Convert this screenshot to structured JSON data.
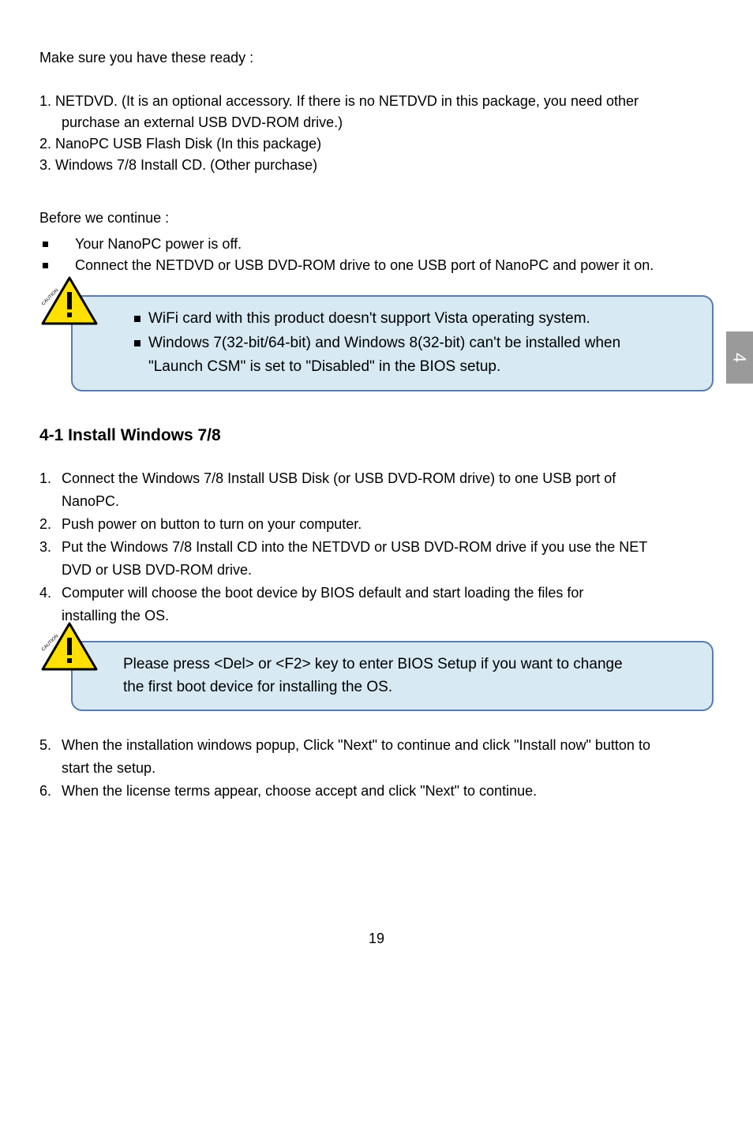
{
  "intro": "Make sure you have these ready :",
  "prereq": {
    "item1a": "1. NETDVD. (It is an optional accessory. If there is no NETDVD in this package, you need other",
    "item1b": "purchase an external USB DVD-ROM drive.)",
    "item2": "2. NanoPC USB Flash Disk (In this package)",
    "item3": "3. Windows 7/8 Install CD. (Other purchase)"
  },
  "before_heading": "Before we continue :",
  "before": {
    "b1": "Your NanoPC power is off.",
    "b2": "Connect the NETDVD or USB DVD-ROM drive to one USB port of NanoPC and power it on."
  },
  "caution_label": "CAUTION",
  "caution1": {
    "l1": "WiFi card with this product doesn't support Vista operating system.",
    "l2": "Windows 7(32-bit/64-bit) and Windows 8(32-bit) can't be installed when",
    "l3": "\"Launch CSM\" is set to \"Disabled\" in the BIOS setup."
  },
  "section_title": "4-1 Install Windows 7/8",
  "steps": {
    "s1a": "Connect the Windows 7/8 Install USB Disk (or USB DVD-ROM drive) to one USB port of",
    "s1b": "NanoPC.",
    "s2": "Push power on button to turn on your computer.",
    "s3a": "Put the Windows 7/8 Install CD into the NETDVD or USB DVD-ROM drive if you use the NET",
    "s3b": "DVD or USB DVD-ROM drive.",
    "s4a": "Computer will choose the boot device by BIOS default and start loading the files for",
    "s4b": "installing the OS.",
    "s5a": "When the installation windows popup,  Click \"Next\" to continue and click \"Install now\" button to",
    "s5b": "start the setup.",
    "s6": "When the license terms appear, choose accept and click \"Next\" to continue."
  },
  "nums": {
    "n1": "1.",
    "n2": "2.",
    "n3": "3.",
    "n4": "4.",
    "n5": "5.",
    "n6": "6."
  },
  "caution2": {
    "l1": " Please press <Del> or <F2> key to enter BIOS Setup if you want to change",
    "l2": "the first boot device for installing the OS."
  },
  "side_tab": "4",
  "page_number": "19"
}
